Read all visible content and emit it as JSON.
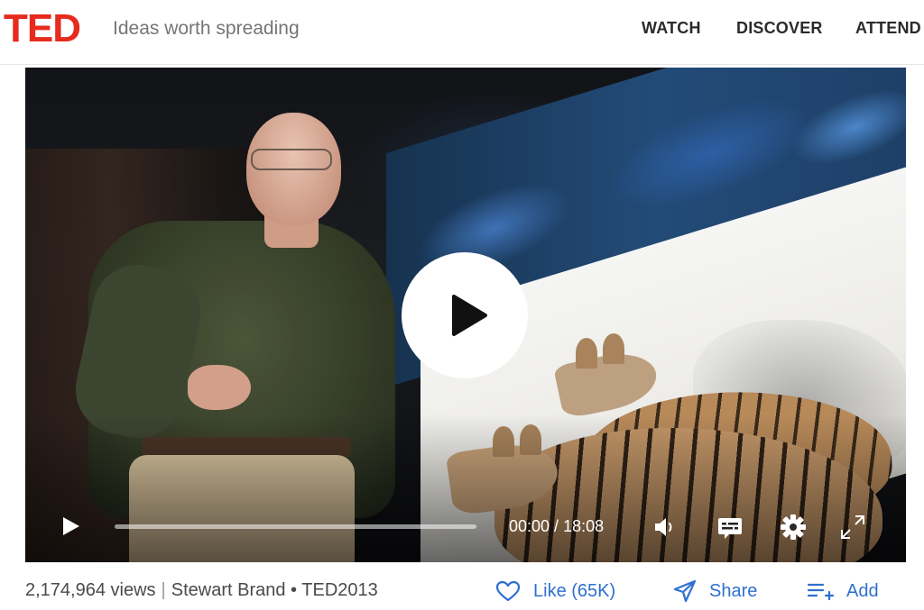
{
  "header": {
    "logo": "TED",
    "tagline": "Ideas worth spreading",
    "nav": [
      "WATCH",
      "DISCOVER",
      "ATTEND"
    ]
  },
  "player": {
    "time_current": "00:00",
    "time_separator": " / ",
    "time_total": "18:08",
    "progress_fraction": 0,
    "icons": [
      "play-icon",
      "volume-icon",
      "captions-icon",
      "settings-icon",
      "fullscreen-icon"
    ]
  },
  "meta": {
    "views": "2,174,964 views",
    "separator": "|",
    "speaker": "Stewart Brand",
    "bullet": "•",
    "event": "TED2013"
  },
  "actions": {
    "like": "Like (65K)",
    "share": "Share",
    "add": "Add"
  },
  "colors": {
    "brand_red": "#e62b1e",
    "action_blue": "#2f6fd0"
  }
}
